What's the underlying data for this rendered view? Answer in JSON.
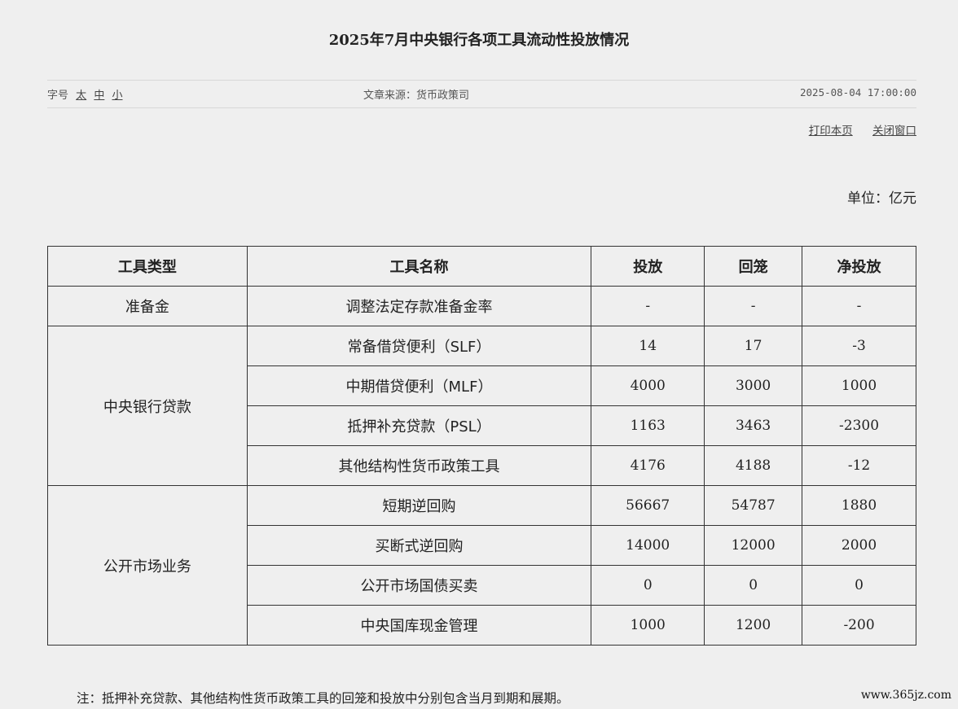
{
  "article": {
    "title": "2025年7月中央银行各项工具流动性投放情况",
    "font_size_label": "字号",
    "font_sizes": [
      "太",
      "中",
      "小"
    ],
    "source": "文章来源：货币政策司",
    "date": "2025-08-04 17:00:00",
    "actions": {
      "print": "打印本页",
      "close": "关闭窗口"
    },
    "unit": "单位：亿元"
  },
  "table": {
    "headers": [
      "工具类型",
      "工具名称",
      "投放",
      "回笼",
      "净投放"
    ],
    "groups": [
      {
        "type": "准备金",
        "rows": [
          {
            "name": "调整法定存款准备金率",
            "inject": "-",
            "withdraw": "-",
            "net": "-"
          }
        ]
      },
      {
        "type": "中央银行贷款",
        "rows": [
          {
            "name": "常备借贷便利（SLF）",
            "inject": "14",
            "withdraw": "17",
            "net": "-3"
          },
          {
            "name": "中期借贷便利（MLF）",
            "inject": "4000",
            "withdraw": "3000",
            "net": "1000"
          },
          {
            "name": "抵押补充贷款（PSL）",
            "inject": "1163",
            "withdraw": "3463",
            "net": "-2300"
          },
          {
            "name": "其他结构性货币政策工具",
            "inject": "4176",
            "withdraw": "4188",
            "net": "-12"
          }
        ]
      },
      {
        "type": "公开市场业务",
        "rows": [
          {
            "name": "短期逆回购",
            "inject": "56667",
            "withdraw": "54787",
            "net": "1880"
          },
          {
            "name": "买断式逆回购",
            "inject": "14000",
            "withdraw": "12000",
            "net": "2000"
          },
          {
            "name": "公开市场国债买卖",
            "inject": "0",
            "withdraw": "0",
            "net": "0"
          },
          {
            "name": "中央国库现金管理",
            "inject": "1000",
            "withdraw": "1200",
            "net": "-200"
          }
        ]
      }
    ]
  },
  "note": "注：抵押补充贷款、其他结构性货币政策工具的回笼和投放中分别包含当月到期和展期。",
  "watermark": "www.365jz.com"
}
